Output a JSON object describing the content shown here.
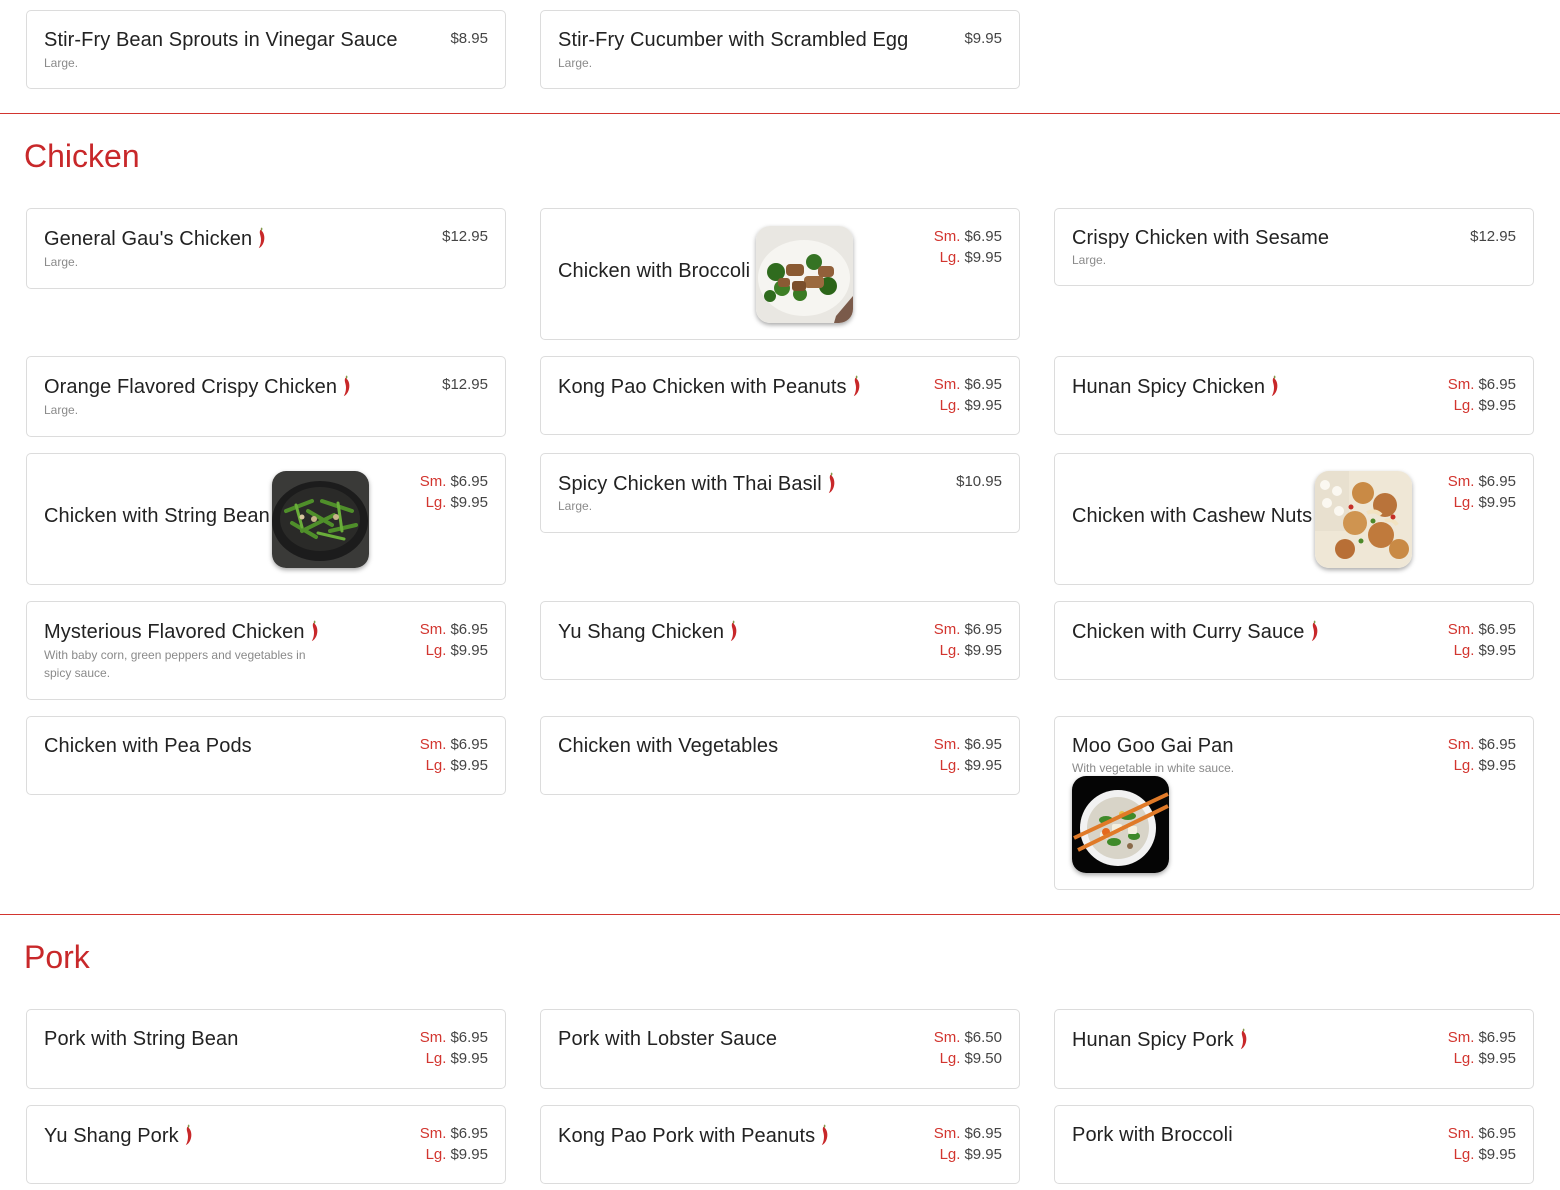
{
  "icons": {
    "spicy": "chili-pepper-icon"
  },
  "colors": {
    "accent": "#c8282a",
    "price_label": "#d2352f",
    "divider": "#d2352f"
  },
  "price_labels": {
    "small": "Sm.",
    "large": "Lg."
  },
  "vegetables": {
    "items": [
      {
        "name": "Stir-Fry Bean Sprouts in Vinegar Sauce",
        "desc": "Large.",
        "price": "$8.95"
      },
      {
        "name": "Stir-Fry Cucumber with Scrambled Egg",
        "desc": "Large.",
        "price": "$9.95"
      }
    ]
  },
  "chicken": {
    "title": "Chicken",
    "items": [
      {
        "name": "General Gau's Chicken",
        "spicy": true,
        "desc": "Large.",
        "price": "$12.95"
      },
      {
        "name": "Chicken with Broccoli",
        "sm": "$6.95",
        "lg": "$9.95",
        "image": "broccoli-chicken-photo"
      },
      {
        "name": "Crispy Chicken with Sesame",
        "desc": "Large.",
        "price": "$12.95"
      },
      {
        "name": "Orange Flavored Crispy Chicken",
        "spicy": true,
        "desc": "Large.",
        "price": "$12.95"
      },
      {
        "name": "Kong Pao Chicken with Peanuts",
        "spicy": true,
        "sm": "$6.95",
        "lg": "$9.95"
      },
      {
        "name": "Hunan Spicy Chicken",
        "spicy": true,
        "sm": "$6.95",
        "lg": "$9.95"
      },
      {
        "name": "Chicken with String Bean",
        "sm": "$6.95",
        "lg": "$9.95",
        "image": "string-bean-chicken-photo"
      },
      {
        "name": "Spicy Chicken with Thai Basil",
        "spicy": true,
        "desc": "Large.",
        "price": "$10.95"
      },
      {
        "name": "Chicken with Cashew Nuts",
        "sm": "$6.95",
        "lg": "$9.95",
        "image": "cashew-chicken-photo"
      },
      {
        "name": "Mysterious Flavored Chicken",
        "spicy": true,
        "desc": "With baby corn, green peppers and vegetables in spicy sauce.",
        "sm": "$6.95",
        "lg": "$9.95"
      },
      {
        "name": "Yu Shang Chicken",
        "spicy": true,
        "sm": "$6.95",
        "lg": "$9.95"
      },
      {
        "name": "Chicken with Curry Sauce",
        "spicy": true,
        "sm": "$6.95",
        "lg": "$9.95"
      },
      {
        "name": "Chicken with Pea Pods",
        "sm": "$6.95",
        "lg": "$9.95"
      },
      {
        "name": "Chicken with Vegetables",
        "sm": "$6.95",
        "lg": "$9.95"
      },
      {
        "name": "Moo Goo Gai Pan",
        "desc": "With vegetable in white sauce.",
        "sm": "$6.95",
        "lg": "$9.95",
        "image": "moo-goo-gai-pan-photo"
      }
    ]
  },
  "pork": {
    "title": "Pork",
    "items": [
      {
        "name": "Pork with String Bean",
        "sm": "$6.95",
        "lg": "$9.95"
      },
      {
        "name": "Pork with Lobster Sauce",
        "sm": "$6.50",
        "lg": "$9.50"
      },
      {
        "name": "Hunan Spicy Pork",
        "spicy": true,
        "sm": "$6.95",
        "lg": "$9.95"
      },
      {
        "name": "Yu Shang Pork",
        "spicy": true,
        "sm": "$6.95",
        "lg": "$9.95"
      },
      {
        "name": "Kong Pao Pork with Peanuts",
        "spicy": true,
        "sm": "$6.95",
        "lg": "$9.95"
      },
      {
        "name": "Pork with Broccoli",
        "sm": "$6.95",
        "lg": "$9.95"
      }
    ]
  }
}
